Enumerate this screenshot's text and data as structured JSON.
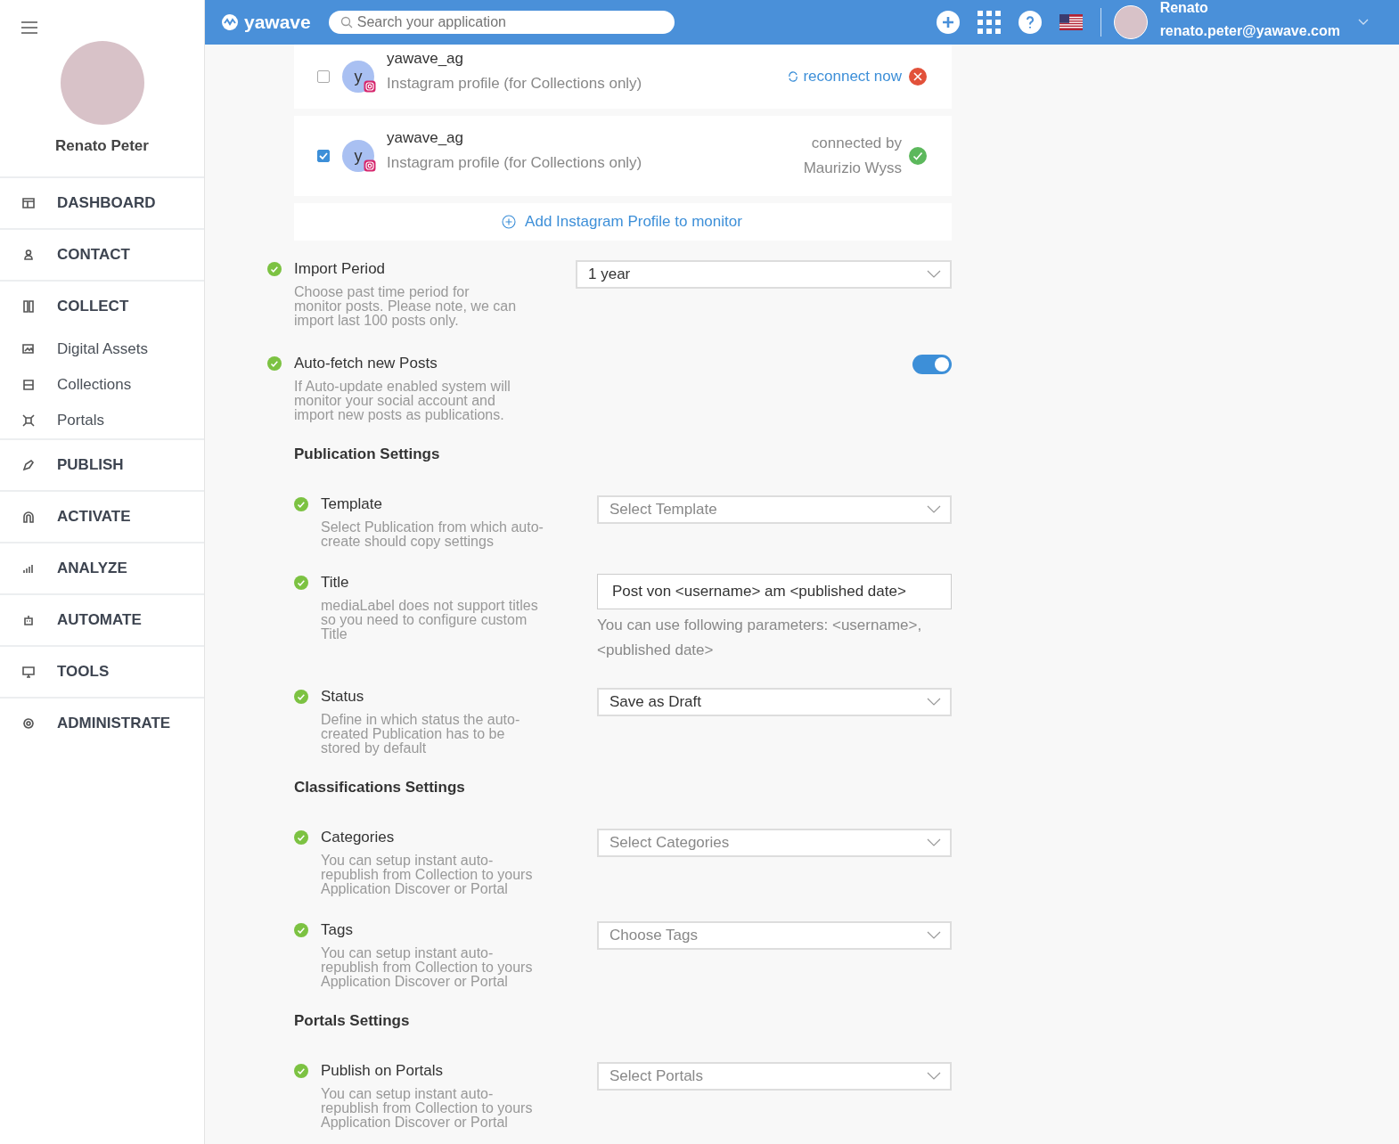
{
  "topbar": {
    "logo": "yawave",
    "search": {
      "placeholder": "Search your application"
    },
    "user_name": "Renato",
    "user_email": "renato.peter@yawave.com"
  },
  "sidebar": {
    "user_name": "Renato Peter",
    "items": [
      {
        "label": "DASHBOARD",
        "kind": "main"
      },
      {
        "label": "CONTACT",
        "kind": "main"
      },
      {
        "label": "COLLECT",
        "kind": "main"
      },
      {
        "label": "Digital Assets",
        "kind": "sub"
      },
      {
        "label": "Collections",
        "kind": "sub"
      },
      {
        "label": "Portals",
        "kind": "sub"
      },
      {
        "label": "PUBLISH",
        "kind": "main"
      },
      {
        "label": "ACTIVATE",
        "kind": "main"
      },
      {
        "label": "ANALYZE",
        "kind": "main"
      },
      {
        "label": "AUTOMATE",
        "kind": "main"
      },
      {
        "label": "TOOLS",
        "kind": "main"
      },
      {
        "label": "ADMINISTRATE",
        "kind": "main"
      }
    ]
  },
  "profiles": [
    {
      "avatar": "y",
      "name": "yawave_ag",
      "description": "Instagram profile (for Collections only)",
      "checked": false,
      "kind": "disconnected",
      "status_lines": [
        "reconnect now"
      ]
    },
    {
      "avatar": "y",
      "name": "yawave_ag",
      "description": "Instagram profile (for Collections only)",
      "checked": true,
      "kind": "connected",
      "status_lines": [
        "connected by",
        "Maurizio Wyss"
      ]
    }
  ],
  "add_profile": "Add Instagram Profile to monitor",
  "settings": [
    {
      "label": "Import Period",
      "description": "Choose past time period for monitor posts. Please note, we can import last 100 posts only.",
      "done": true,
      "control": {
        "kind": "select",
        "value": "1 year"
      }
    },
    {
      "label": "Auto-fetch new Posts",
      "description": "If Auto-update enabled system will monitor your social account and import new posts as publications.",
      "done": true,
      "control": {
        "kind": "toggle",
        "on": true
      }
    }
  ],
  "sections": [
    {
      "title": "Publication Settings",
      "settings": [
        {
          "label": "Template",
          "description": "Select Publication from which auto-create should copy settings",
          "done": true,
          "control": {
            "kind": "select",
            "placeholder": "Select Template"
          }
        },
        {
          "label": "Title",
          "description": "mediaLabel does not support titles so you need to configure custom Title",
          "done": true,
          "control": {
            "kind": "text",
            "value": "Post von <username> am <published date>",
            "hint": "You can use following parameters: <username>, <published date>"
          }
        },
        {
          "label": "Status",
          "description": "Define in which status the auto-created Publication has to be stored by default",
          "done": true,
          "control": {
            "kind": "select",
            "value": "Save as Draft"
          }
        }
      ]
    },
    {
      "title": "Classifications Settings",
      "settings": [
        {
          "label": "Categories",
          "description": "You can setup instant auto-republish from Collection to yours Application Discover or Portal",
          "done": true,
          "control": {
            "kind": "select",
            "placeholder": "Select Categories"
          }
        },
        {
          "label": "Tags",
          "description": "You can setup instant auto-republish from Collection to yours Application Discover or Portal",
          "done": true,
          "control": {
            "kind": "select",
            "placeholder": "Choose Tags"
          }
        }
      ]
    },
    {
      "title": "Portals Settings",
      "settings": [
        {
          "label": "Publish on Portals",
          "description": "You can setup instant auto-republish from Collection to yours Application Discover or Portal",
          "done": true,
          "control": {
            "kind": "select",
            "placeholder": "Select Portals"
          }
        }
      ]
    }
  ]
}
